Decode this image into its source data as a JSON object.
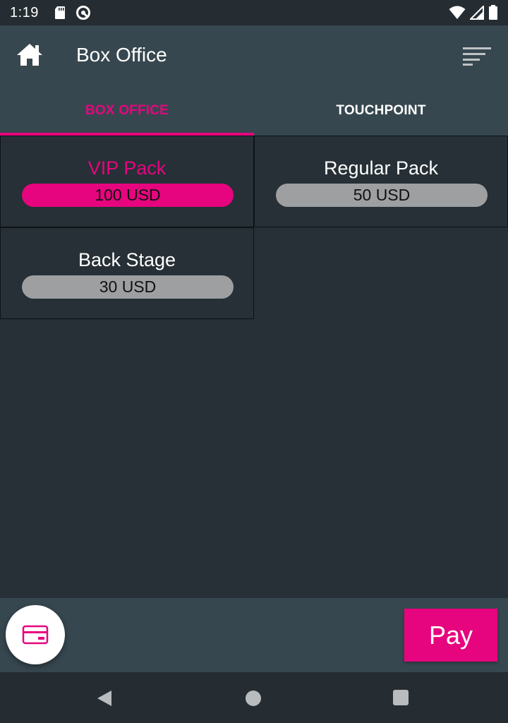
{
  "status_bar": {
    "time": "1:19",
    "icons": [
      "sd-card-icon",
      "sync-icon",
      "wifi-icon",
      "signal-icon",
      "battery-icon"
    ]
  },
  "app_bar": {
    "title": "Box Office",
    "icons": [
      "home-icon",
      "sort-icon"
    ]
  },
  "tabs": [
    {
      "label": "BOX OFFICE",
      "active": true
    },
    {
      "label": "TOUCHPOINT",
      "active": false
    }
  ],
  "products": [
    {
      "name": "VIP Pack",
      "price": "100 USD",
      "selected": true
    },
    {
      "name": "Regular Pack",
      "price": "50 USD",
      "selected": false
    },
    {
      "name": "Back Stage",
      "price": "30 USD",
      "selected": false
    }
  ],
  "bottom_bar": {
    "pay_label": "Pay",
    "card_icon": "credit-card-icon"
  },
  "colors": {
    "accent": "#e6057e",
    "app_bar": "#37474f",
    "background": "#263036",
    "pill_inactive": "#9e9fa1"
  },
  "nav_bar": {
    "icons": [
      "back-icon",
      "home-circle-icon",
      "recents-icon"
    ]
  }
}
